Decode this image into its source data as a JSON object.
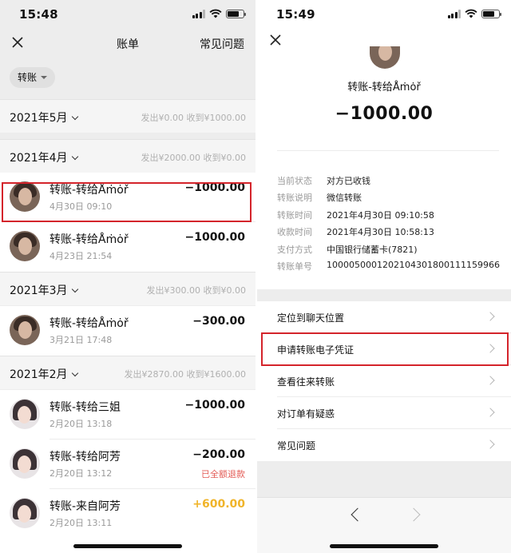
{
  "left": {
    "status": {
      "time": "15:48"
    },
    "nav": {
      "title": "账单",
      "faq": "常见问题"
    },
    "filter": {
      "label": "转账"
    },
    "months": [
      {
        "label": "2021年5月",
        "stats": "发出¥0.00  收到¥1000.00"
      },
      {
        "label": "2021年4月",
        "stats": "发出¥2000.00  收到¥0.00"
      },
      {
        "label": "2021年3月",
        "stats": "发出¥300.00  收到¥0.00"
      },
      {
        "label": "2021年2月",
        "stats": "发出¥2870.00  收到¥1600.00"
      }
    ],
    "transactions": [
      {
        "title": "转账-转给Åṁȯř",
        "date": "4月30日 09:10",
        "amount": "−1000.00"
      },
      {
        "title": "转账-转给Åṁȯř",
        "date": "4月23日 21:54",
        "amount": "−1000.00"
      },
      {
        "title": "转账-转给Åṁȯř",
        "date": "3月21日 17:48",
        "amount": "−300.00"
      },
      {
        "title": "转账-转给三姐",
        "date": "2月20日 13:18",
        "amount": "−1000.00"
      },
      {
        "title": "转账-转给阿芳",
        "date": "2月20日 13:12",
        "amount": "−200.00",
        "note": "已全额退款"
      },
      {
        "title": "转账-来自阿芳",
        "date": "2月20日 13:11",
        "amount": "+600.00"
      }
    ]
  },
  "right": {
    "status": {
      "time": "15:49"
    },
    "payee": "转账-转给Åṁȯř",
    "amount": "−1000.00",
    "details": [
      {
        "key": "当前状态",
        "value": "对方已收钱"
      },
      {
        "key": "转账说明",
        "value": "微信转账"
      },
      {
        "key": "转账时间",
        "value": "2021年4月30日 09:10:58"
      },
      {
        "key": "收款时间",
        "value": "2021年4月30日 10:58:13"
      },
      {
        "key": "支付方式",
        "value": "中国银行储蓄卡(7821)"
      },
      {
        "key": "转账单号",
        "value": "1000050001202104301800111159966"
      }
    ],
    "menu": [
      {
        "label": "定位到聊天位置"
      },
      {
        "label": "申请转账电子凭证"
      },
      {
        "label": "查看往来转账"
      },
      {
        "label": "对订单有疑惑"
      },
      {
        "label": "常见问题"
      }
    ]
  },
  "colors": {
    "highlight": "#d4242b",
    "income": "#f0b429",
    "refund_note": "#e35b55"
  }
}
